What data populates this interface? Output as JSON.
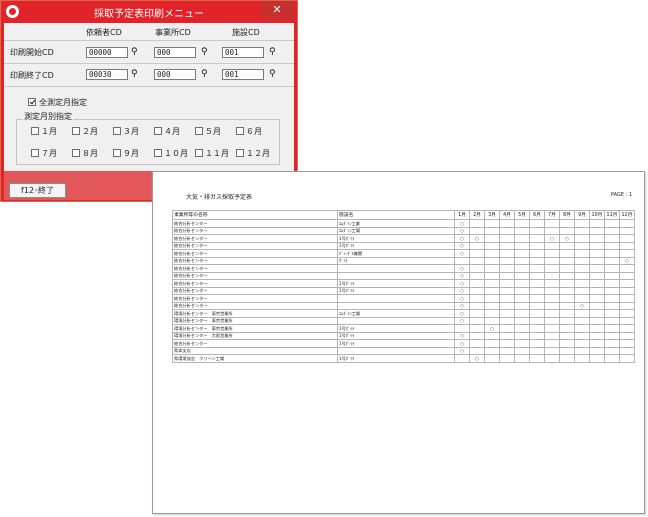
{
  "window": {
    "title": "採取予定表印刷メニュー",
    "close_glyph": "✕"
  },
  "columns": {
    "requester": "依頼者CD",
    "office": "事業所CD",
    "facility": "施設CD"
  },
  "start": {
    "label": "印刷開始CD",
    "requester_value": "00000",
    "office_value": "000",
    "facility_value": "001"
  },
  "end": {
    "label": "印刷終了CD",
    "requester_value": "00030",
    "office_value": "000",
    "facility_value": "001"
  },
  "all_months": {
    "label": "全測定月指定",
    "checked": true
  },
  "month_group": {
    "title": "測定月別指定",
    "months": [
      "１月",
      "２月",
      "３月",
      "４月",
      "５月",
      "６月",
      "７月",
      "８月",
      "９月",
      "１０月",
      "１１月",
      "１２月"
    ]
  },
  "footer": {
    "exit_button": "f12･終了"
  },
  "report": {
    "title": "大気・排ガス採取予定表",
    "page": "PAGE : 1",
    "header_name": "事業所等の名称",
    "header_facility": "施設名",
    "month_headers": [
      "1月",
      "2月",
      "3月",
      "4月",
      "5月",
      "6月",
      "7月",
      "8月",
      "9月",
      "10月",
      "11月",
      "12月"
    ],
    "mark": "○",
    "rows": [
      {
        "name": "総合分析センター",
        "facility": "ｴﾑﾀﾞｲﾝ工業",
        "months": [
          1
        ]
      },
      {
        "name": "総合分析センター",
        "facility": "ｴﾑﾀﾞｲﾝ工場",
        "months": [
          1
        ]
      },
      {
        "name": "総合分析センター",
        "facility": "1号ﾎﾞｲﾗ",
        "months": [
          1,
          2,
          7,
          8
        ]
      },
      {
        "name": "総合分析センター",
        "facility": "1号ﾎﾞｲﾗ",
        "months": [
          1
        ]
      },
      {
        "name": "総合分析センター",
        "facility": "ﾃﾞｨｰｾﾞﾙ機関",
        "months": [
          1
        ]
      },
      {
        "name": "総合分析センター",
        "facility": "ﾎﾞｲﾗ",
        "months": [
          12
        ]
      },
      {
        "name": "総合分析センター",
        "facility": "",
        "months": [
          1
        ]
      },
      {
        "name": "総合分析センター",
        "facility": "",
        "months": [
          1
        ]
      },
      {
        "name": "総合分析センター",
        "facility": "1号ﾎﾞｲﾗ",
        "months": [
          1
        ]
      },
      {
        "name": "総合分析センター",
        "facility": "1号ﾎﾞｲﾗ",
        "months": [
          1
        ]
      },
      {
        "name": "総合分析センター",
        "facility": "",
        "months": [
          1
        ]
      },
      {
        "name": "総合分析センター",
        "facility": "",
        "months": [
          1,
          9
        ]
      },
      {
        "name": "環境分析センター　東京営業所",
        "facility": "ｴﾑﾀﾞｲﾝ工場",
        "months": [
          1
        ]
      },
      {
        "name": "環境分析センター　東京営業所",
        "facility": "",
        "months": [
          1
        ]
      },
      {
        "name": "環境分析センター　東京営業所",
        "facility": "1号ﾎﾞｲﾗ",
        "months": [
          3
        ]
      },
      {
        "name": "環境分析センター　大阪営業所",
        "facility": "1号ﾎﾞｲﾗ",
        "months": [
          1
        ]
      },
      {
        "name": "総合分析センター",
        "facility": "1号ﾎﾞｲﾗ",
        "months": [
          1
        ]
      },
      {
        "name": "県本支店",
        "facility": "",
        "months": [
          1
        ]
      },
      {
        "name": "県環境協会　クリーン工場",
        "facility": "1号ﾎﾞｲﾗ",
        "months": [
          2
        ]
      }
    ]
  },
  "icons": {
    "search": "binoculars-icon"
  }
}
